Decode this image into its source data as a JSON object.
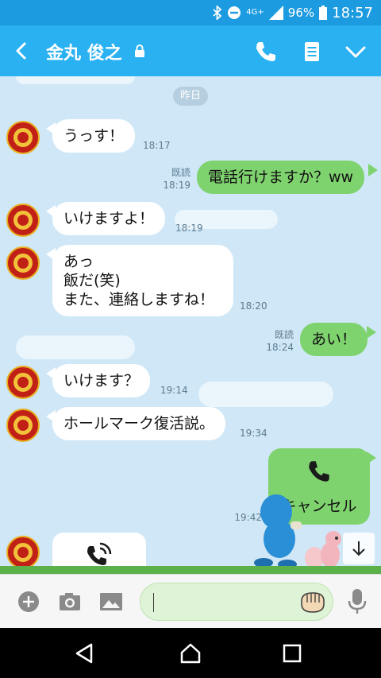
{
  "status_bar": {
    "network": "4G+",
    "battery": "96%",
    "time": "18:57"
  },
  "header": {
    "contact_name": "金丸 俊之"
  },
  "chat": {
    "date_separator": "昨日",
    "read_label": "既読",
    "messages": [
      {
        "text": "うっす！",
        "time": "18:17"
      },
      {
        "text": "電話行けますか？ww",
        "time": "18:19"
      },
      {
        "text": "いけますよ！",
        "time": "18:19"
      },
      {
        "line1": "あっ",
        "line2": "飯だ(笑)",
        "line3": "また、連絡しますね！",
        "time": "18:20"
      },
      {
        "text": "あい！",
        "time": "18:24"
      },
      {
        "text": "いけます？",
        "time": "19:14"
      },
      {
        "text": "ホールマーク復活説。",
        "time": "19:34"
      },
      {
        "text": "キャンセル",
        "time": "19:42"
      }
    ]
  },
  "colors": {
    "header": "#2ab1f2",
    "chat_background": "#cfe7f6",
    "outgoing_bubble": "#7fd36f",
    "incoming_bubble": "#ffffff"
  }
}
